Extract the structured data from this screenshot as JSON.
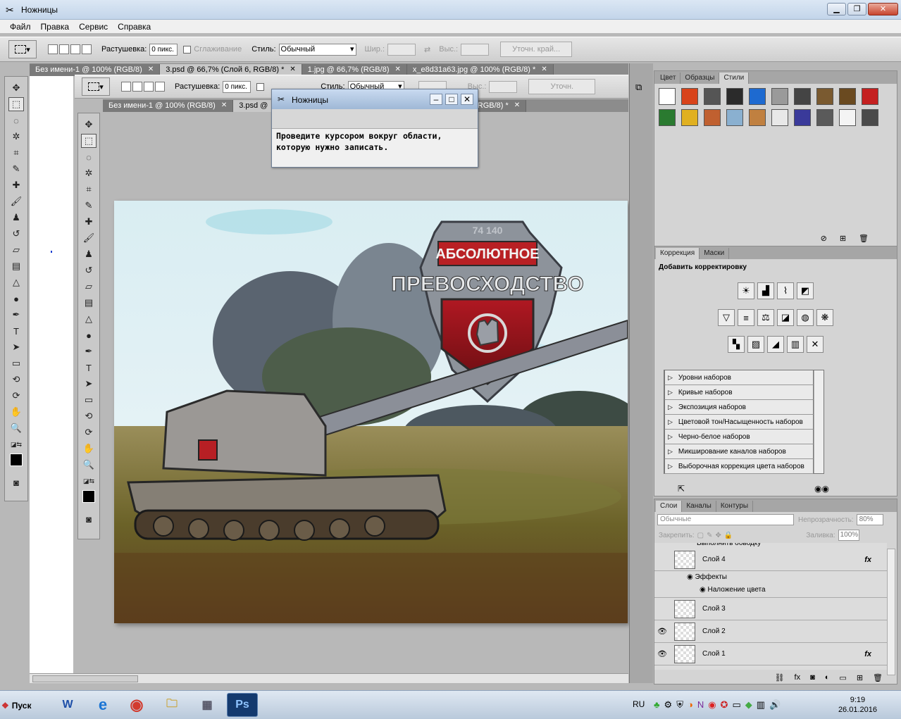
{
  "window": {
    "title": "Ножницы"
  },
  "menu": [
    "Файл",
    "Правка",
    "Сервис",
    "Справка"
  ],
  "options_outer": {
    "feather_label": "Растушевка:",
    "feather_value": "0 пикс.",
    "antialias_label": "Сглаживание",
    "style_label": "Стиль:",
    "style_value": "Обычный",
    "width_label": "Шир.:",
    "height_label": "Выс.:",
    "refine_label": "Уточн. край..."
  },
  "options_inner": {
    "feather_label": "Растушевка:",
    "feather_value": "0 пикс.",
    "style_label": "Стиль:",
    "style_value": "Обычный",
    "height_label": "Выс.:",
    "refine_label": "Уточн."
  },
  "tabs_outer": [
    {
      "label": "Без имени-1 @ 100% (RGB/8)",
      "active": false
    },
    {
      "label": "3.psd @ 66,7% (Слой 6, RGB/8) *",
      "active": true
    },
    {
      "label": "1.jpg @ 66,7% (RGB/8)",
      "active": false
    },
    {
      "label": "x_e8d31a63.jpg @ 100% (RGB/8) *",
      "active": false
    }
  ],
  "tabs_inner": [
    {
      "label": "Без имени-1 @ 100% (RGB/8)",
      "active": false
    },
    {
      "label": "3.psd @",
      "active": true
    },
    {
      "label": "x_e8d31a63.jpg @ 100% (RGB/8) *",
      "active": false
    }
  ],
  "snip": {
    "title": "Ножницы",
    "message_1": "Проведите курсором вокруг области,",
    "message_2": "которую нужно записать."
  },
  "image": {
    "badge_top": "74 140",
    "badge_line1": "АБСОЛЮТНОЕ",
    "badge_line2": "ПРЕВОСХОДСТВО"
  },
  "styles_panel": {
    "tabs": [
      "Цвет",
      "Образцы",
      "Стили"
    ],
    "swatches": [
      "#ffffff",
      "#d8431a",
      "#555555",
      "#2b2b2b",
      "#1e6ad0",
      "#9a9a9a",
      "#444444",
      "#7a5a30",
      "#6a4a20",
      "#c42020",
      "#2a7a30",
      "#e0b020",
      "#c06030",
      "#8ab0d0",
      "#c08040",
      "#e8e8e8",
      "#3a3a9a",
      "#5a5a5a",
      "#f4f4f4",
      "#4a4a4a"
    ]
  },
  "adjust_panel": {
    "tabs": [
      "Коррекция",
      "Маски"
    ],
    "heading": "Добавить корректировку",
    "presets": [
      "Уровни наборов",
      "Кривые наборов",
      "Экспозиция наборов",
      "Цветовой тон/Насыщенность наборов",
      "Черно-белое наборов",
      "Микширование каналов наборов",
      "Выборочная коррекция цвета наборов"
    ]
  },
  "layers_panel": {
    "tabs": [
      "Слои",
      "Каналы",
      "Контуры"
    ],
    "blend": "Обычные",
    "opacity_label": "Непрозрачность:",
    "opacity_value": "80%",
    "lock_label": "Закрепить:",
    "fill_label": "Заливка:",
    "fill_value": "100%",
    "partial_row": "Выполнить обводку",
    "layers": [
      {
        "name": "Слой 4",
        "visible": false,
        "fx": "fx"
      },
      {
        "name": "Слой 3",
        "visible": false,
        "fx": ""
      },
      {
        "name": "Слой 2",
        "visible": true,
        "fx": ""
      },
      {
        "name": "Слой 1",
        "visible": true,
        "fx": "fx"
      }
    ],
    "effects_label": "Эффекты",
    "effect_item": "Наложение цвета"
  },
  "taskbar": {
    "start": "Пуск",
    "apps": [
      "W",
      "e",
      "◉",
      "🗀",
      "▦",
      "Ps"
    ],
    "lang": "RU",
    "time": "9:19",
    "date": "26.01.2016"
  },
  "colors": {
    "accent": "#c42020",
    "panel": "#d4d4d4",
    "workspace": "#b8b8b8"
  }
}
